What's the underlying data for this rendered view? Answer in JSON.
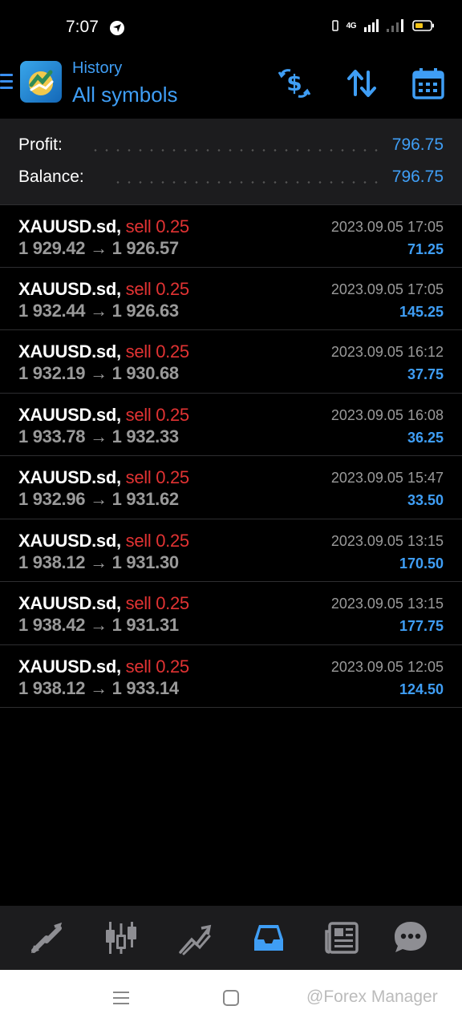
{
  "status_bar": {
    "time": "7:07",
    "network": "4G",
    "icons": [
      "navigation-icon",
      "vibrate-icon",
      "signal-icon",
      "signal-icon",
      "battery-icon"
    ]
  },
  "header": {
    "subtitle": "History",
    "title": "All symbols",
    "actions": [
      "currency-exchange-icon",
      "sort-icon",
      "calendar-icon"
    ],
    "accent_color": "#3f9ef5"
  },
  "summary": {
    "profit_label": "Profit:",
    "profit_value": "796.75",
    "balance_label": "Balance:",
    "balance_value": "796.75"
  },
  "trades": [
    {
      "symbol": "XAUUSD.sd,",
      "side": "sell 0.25",
      "open": "1 929.42",
      "arrow": "→",
      "close": "1 926.57",
      "datetime": "2023.09.05 17:05",
      "profit": "71.25"
    },
    {
      "symbol": "XAUUSD.sd,",
      "side": "sell 0.25",
      "open": "1 932.44",
      "arrow": "→",
      "close": "1 926.63",
      "datetime": "2023.09.05 17:05",
      "profit": "145.25"
    },
    {
      "symbol": "XAUUSD.sd,",
      "side": "sell 0.25",
      "open": "1 932.19",
      "arrow": "→",
      "close": "1 930.68",
      "datetime": "2023.09.05 16:12",
      "profit": "37.75"
    },
    {
      "symbol": "XAUUSD.sd,",
      "side": "sell 0.25",
      "open": "1 933.78",
      "arrow": "→",
      "close": "1 932.33",
      "datetime": "2023.09.05 16:08",
      "profit": "36.25"
    },
    {
      "symbol": "XAUUSD.sd,",
      "side": "sell 0.25",
      "open": "1 932.96",
      "arrow": "→",
      "close": "1 931.62",
      "datetime": "2023.09.05 15:47",
      "profit": "33.50"
    },
    {
      "symbol": "XAUUSD.sd,",
      "side": "sell 0.25",
      "open": "1 938.12",
      "arrow": "→",
      "close": "1 931.30",
      "datetime": "2023.09.05 13:15",
      "profit": "170.50"
    },
    {
      "symbol": "XAUUSD.sd,",
      "side": "sell 0.25",
      "open": "1 938.42",
      "arrow": "→",
      "close": "1 931.31",
      "datetime": "2023.09.05 13:15",
      "profit": "177.75"
    },
    {
      "symbol": "XAUUSD.sd,",
      "side": "sell 0.25",
      "open": "1 938.12",
      "arrow": "→",
      "close": "1 933.14",
      "datetime": "2023.09.05 12:05",
      "profit": "124.50"
    }
  ],
  "tabbar": {
    "tabs": [
      "quotes-icon",
      "chart-icon",
      "trade-icon",
      "history-icon",
      "news-icon",
      "chat-icon"
    ],
    "active": "history-icon"
  },
  "system_nav": {
    "icons": [
      "recent-apps-icon",
      "home-icon"
    ],
    "watermark": "@Forex Manager"
  },
  "colors": {
    "sell": "#e23333",
    "profit": "#3f9ef5",
    "muted": "#9a9a9a",
    "panel": "#1c1c1e"
  }
}
